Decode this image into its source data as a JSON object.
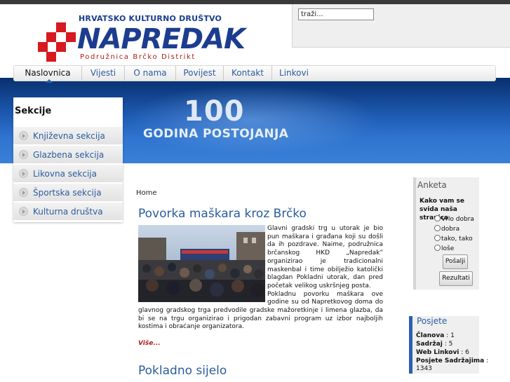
{
  "header": {
    "tagline": "HRVATSKO KULTURNO DRUŠTVO",
    "brand": "NAPREDAK",
    "subtitle": "Podružnica Brčko Distrikt",
    "search_placeholder": "traži..."
  },
  "nav": {
    "items": [
      {
        "label": "Naslovnica",
        "active": true
      },
      {
        "label": "Vijesti",
        "active": false
      },
      {
        "label": "O nama",
        "active": false
      },
      {
        "label": "Povijest",
        "active": false
      },
      {
        "label": "Kontakt",
        "active": false
      },
      {
        "label": "Linkovi",
        "active": false
      }
    ]
  },
  "banner": {
    "number": "100",
    "text": "GODINA POSTOJANJA"
  },
  "sidebar": {
    "title": "Sekcije",
    "items": [
      {
        "label": "Književna sekcija"
      },
      {
        "label": "Glazbena sekcija"
      },
      {
        "label": "Likovna sekcija"
      },
      {
        "label": "Športska sekcija"
      },
      {
        "label": "Kulturna društva"
      }
    ]
  },
  "content": {
    "breadcrumb": "Home",
    "article1": {
      "title": "Povorka maškara kroz Brčko",
      "p1": "Glavni gradski trg u utorak je bio pun maškara i građana koji su došli da ih pozdrave. Naime, podružnica brčanskog HKD „Napredak” organizirao je tradicionalni maskenbal i time obilježio katolički blagdan Pokladni utorak, dan pred početak velikog uskršnjeg posta.",
      "p2": "Pokladnu povorku maškara ove godine su od Napretkovog doma do glavnog gradskog trga predvodile gradske mažoretkinje i limena glazba, da bi se na trgu organizirao i prigodan zabavni program uz izbor najboljih kostima i obraćanje organizatora.",
      "more": "Više..."
    },
    "article2": {
      "title": "Pokladno sijelo"
    }
  },
  "poll": {
    "title": "Anketa",
    "question": "Kako vam se svida naša stranica",
    "options": [
      "Vrlo dobra",
      "dobra",
      "tako, tako",
      "loše"
    ],
    "vote_label": "Pošalji",
    "results_label": "Rezultati"
  },
  "visits": {
    "title": "Posjete",
    "stats": [
      {
        "label": "Članova",
        "value": "1"
      },
      {
        "label": "Sadržaj",
        "value": "5"
      },
      {
        "label": "Web Linkovi",
        "value": "6"
      },
      {
        "label": "Posjete Sadržajima",
        "value": "1343"
      }
    ]
  },
  "colors": {
    "brand_blue": "#1c3d8f",
    "brand_red": "#d71920",
    "link_blue": "#2b5c9e",
    "banner_blue": "#1e5bb4"
  }
}
